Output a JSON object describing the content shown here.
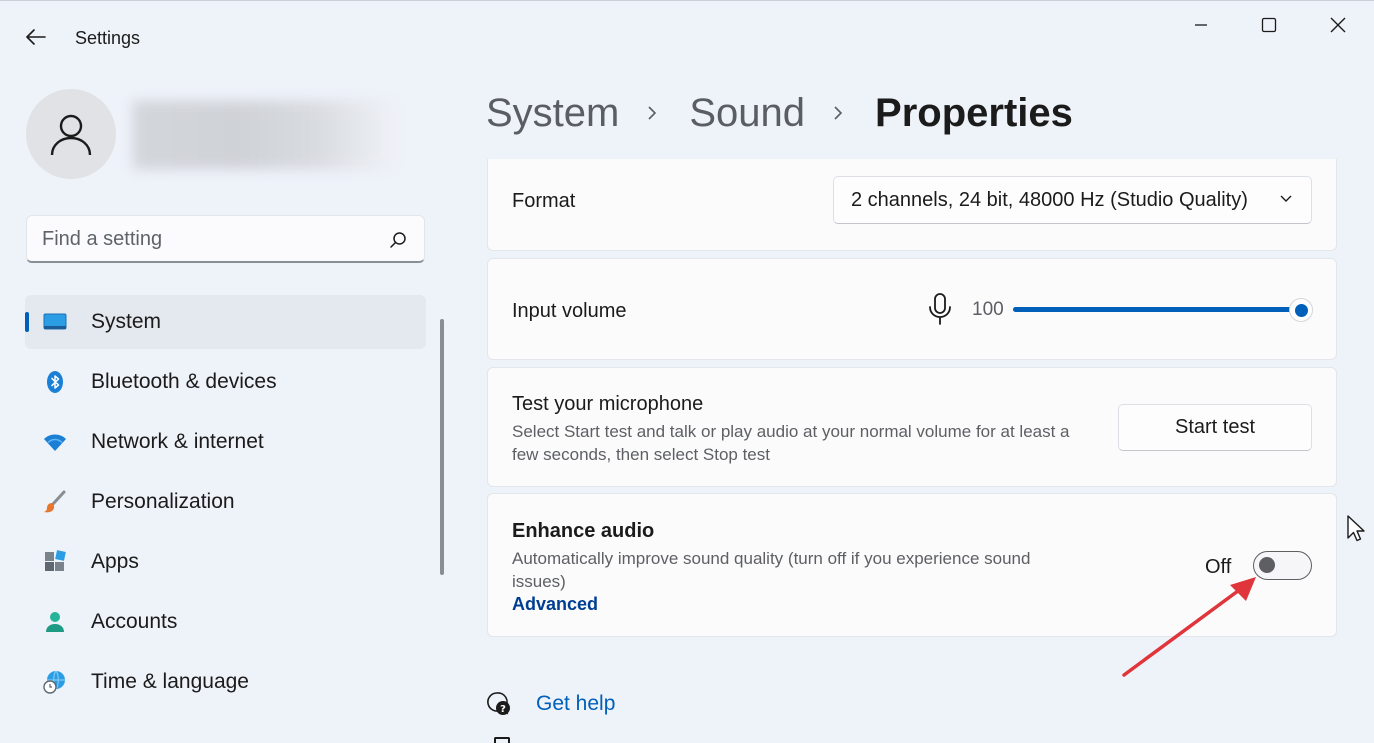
{
  "window": {
    "title": "Settings"
  },
  "sidebar": {
    "search_placeholder": "Find a setting",
    "items": [
      {
        "label": "System",
        "icon": "system-icon",
        "active": true
      },
      {
        "label": "Bluetooth & devices",
        "icon": "bluetooth-icon",
        "active": false
      },
      {
        "label": "Network & internet",
        "icon": "wifi-icon",
        "active": false
      },
      {
        "label": "Personalization",
        "icon": "brush-icon",
        "active": false
      },
      {
        "label": "Apps",
        "icon": "apps-icon",
        "active": false
      },
      {
        "label": "Accounts",
        "icon": "accounts-icon",
        "active": false
      },
      {
        "label": "Time & language",
        "icon": "globe-clock-icon",
        "active": false
      }
    ]
  },
  "breadcrumb": [
    "System",
    "Sound",
    "Properties"
  ],
  "format": {
    "label": "Format",
    "value": "2 channels, 24 bit, 48000 Hz (Studio Quality)"
  },
  "input_volume": {
    "label": "Input volume",
    "value": "100",
    "level_percent": 100
  },
  "test_mic": {
    "title": "Test your microphone",
    "description": "Select Start test and talk or play audio at your normal volume for at least a few seconds, then select Stop test",
    "button": "Start test"
  },
  "enhance_audio": {
    "title": "Enhance audio",
    "description": "Automatically improve sound quality (turn off if you experience sound issues)",
    "link": "Advanced",
    "state_label": "Off",
    "enabled": false
  },
  "help": {
    "get_help": "Get help"
  },
  "colors": {
    "accent": "#005fb8",
    "annotation_arrow": "#e0353a"
  }
}
